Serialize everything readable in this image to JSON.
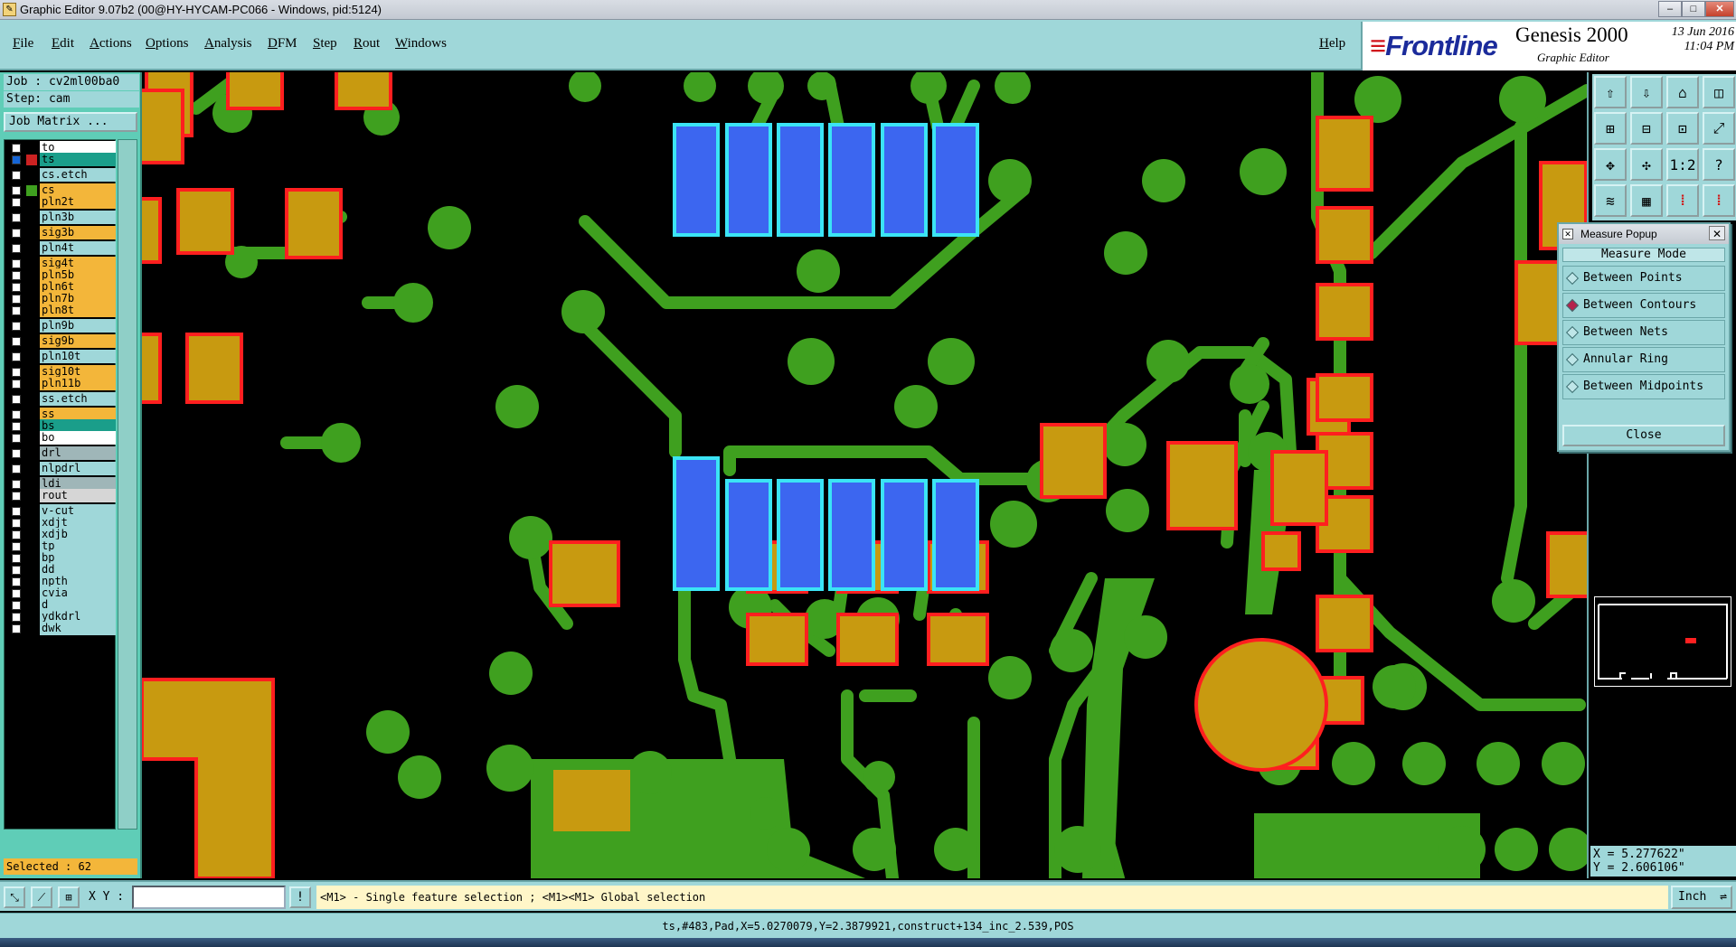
{
  "window": {
    "title": "Graphic Editor 9.07b2 (00@HY-HYCAM-PC066 - Windows, pid:5124)"
  },
  "menubar": {
    "items": [
      "File",
      "Edit",
      "Actions",
      "Options",
      "Analysis",
      "DFM",
      "Step",
      "Rout",
      "Windows"
    ],
    "help": "Help"
  },
  "brand": {
    "logo": "Frontline",
    "product": "Genesis 2000",
    "subtitle": "Graphic Editor",
    "date": "13 Jun 2016",
    "time": "11:04 PM"
  },
  "job": {
    "job_line": "Job : cv2ml00ba0",
    "step_line": "Step: cam",
    "matrix_button": "Job Matrix ..."
  },
  "layers": [
    {
      "name": "to",
      "color": "#ffffff",
      "swatch": "#000000",
      "checked": false
    },
    {
      "name": "ts",
      "color": "#1a9e8a",
      "swatch": "#cc2222",
      "checked": true
    },
    {
      "name": "cs.etch",
      "color": "#9fd7d9",
      "swatch": "#000000",
      "checked": false
    },
    {
      "name": "cs",
      "color": "#f3b63a",
      "swatch": "#3fa01f",
      "checked": false
    },
    {
      "name": "pln2t",
      "color": "#f3b63a",
      "swatch": "#000000",
      "checked": false
    },
    {
      "name": "pln3b",
      "color": "#9fd7d9",
      "swatch": "#000000",
      "checked": false
    },
    {
      "name": "sig3b",
      "color": "#f3b63a",
      "swatch": "#000000",
      "checked": false
    },
    {
      "name": "pln4t",
      "color": "#9fd7d9",
      "swatch": "#000000",
      "checked": false
    },
    {
      "name": "sig4t",
      "color": "#f3b63a",
      "swatch": "#000000",
      "checked": false
    },
    {
      "name": "pln5b",
      "color": "#f3b63a",
      "swatch": "#000000",
      "checked": false
    },
    {
      "name": "pln6t",
      "color": "#f3b63a",
      "swatch": "#000000",
      "checked": false
    },
    {
      "name": "pln7b",
      "color": "#f3b63a",
      "swatch": "#000000",
      "checked": false
    },
    {
      "name": "pln8t",
      "color": "#f3b63a",
      "swatch": "#000000",
      "checked": false
    },
    {
      "name": "pln9b",
      "color": "#9fd7d9",
      "swatch": "#000000",
      "checked": false
    },
    {
      "name": "sig9b",
      "color": "#f3b63a",
      "swatch": "#000000",
      "checked": false
    },
    {
      "name": "pln10t",
      "color": "#9fd7d9",
      "swatch": "#000000",
      "checked": false
    },
    {
      "name": "sig10t",
      "color": "#f3b63a",
      "swatch": "#000000",
      "checked": false
    },
    {
      "name": "pln11b",
      "color": "#f3b63a",
      "swatch": "#000000",
      "checked": false
    },
    {
      "name": "ss.etch",
      "color": "#9fd7d9",
      "swatch": "#000000",
      "checked": false
    },
    {
      "name": "ss",
      "color": "#f3b63a",
      "swatch": "#000000",
      "checked": false
    },
    {
      "name": "bs",
      "color": "#1a9e8a",
      "swatch": "#000000",
      "checked": false
    },
    {
      "name": "bo",
      "color": "#ffffff",
      "swatch": "#000000",
      "checked": false
    },
    {
      "name": "drl",
      "color": "#9fb6b8",
      "swatch": "#000000",
      "checked": false
    },
    {
      "name": "nlpdrl",
      "color": "#9fd7d9",
      "swatch": "#000000",
      "checked": false
    },
    {
      "name": "ldi",
      "color": "#9fb6b8",
      "swatch": "#000000",
      "checked": false
    },
    {
      "name": "rout",
      "color": "#d6d6d6",
      "swatch": "#000000",
      "checked": false
    },
    {
      "name": "v-cut",
      "color": "#9fd7d9",
      "swatch": "#000000",
      "checked": false
    },
    {
      "name": "xdjt",
      "color": "#9fd7d9",
      "swatch": "#000000",
      "checked": false
    },
    {
      "name": "xdjb",
      "color": "#9fd7d9",
      "swatch": "#000000",
      "checked": false
    },
    {
      "name": "tp",
      "color": "#9fd7d9",
      "swatch": "#000000",
      "checked": false
    },
    {
      "name": "bp",
      "color": "#9fd7d9",
      "swatch": "#000000",
      "checked": false
    },
    {
      "name": "dd",
      "color": "#9fd7d9",
      "swatch": "#000000",
      "checked": false
    },
    {
      "name": "npth",
      "color": "#9fd7d9",
      "swatch": "#000000",
      "checked": false
    },
    {
      "name": "cvia",
      "color": "#9fd7d9",
      "swatch": "#000000",
      "checked": false
    },
    {
      "name": "d",
      "color": "#9fd7d9",
      "swatch": "#000000",
      "checked": false
    },
    {
      "name": "ydkdrl",
      "color": "#9fd7d9",
      "swatch": "#000000",
      "checked": false
    },
    {
      "name": "dwk",
      "color": "#9fd7d9",
      "swatch": "#000000",
      "checked": false
    }
  ],
  "selection": {
    "label": "Selected : 62"
  },
  "measure_popup": {
    "title": "Measure Popup",
    "header": "Measure Mode",
    "options": [
      {
        "label": "Between Points",
        "selected": false
      },
      {
        "label": "Between Contours",
        "selected": true
      },
      {
        "label": "Between Nets",
        "selected": false
      },
      {
        "label": "Annular Ring",
        "selected": false
      },
      {
        "label": "Between Midpoints",
        "selected": false
      }
    ],
    "close": "Close"
  },
  "tools": [
    {
      "icon": "home-icon"
    },
    {
      "icon": "save-icon"
    },
    {
      "icon": "house-icon"
    },
    {
      "icon": "panel-icon"
    },
    {
      "icon": "zoom-in-icon"
    },
    {
      "icon": "zoom-out-icon"
    },
    {
      "icon": "zoom-area-icon"
    },
    {
      "icon": "pan-icon"
    },
    {
      "icon": "fit-icon"
    },
    {
      "icon": "center-icon"
    },
    {
      "icon": "ratio-icon"
    },
    {
      "icon": "help-icon"
    },
    {
      "icon": "layer-icon"
    },
    {
      "icon": "grid-icon"
    },
    {
      "icon": "snap-red-icon"
    },
    {
      "icon": "snap-red2-icon"
    }
  ],
  "tool_glyphs": [
    "⇧",
    "⇩",
    "⌂",
    "◫",
    "⊞",
    "⊟",
    "⊡",
    "⤢",
    "✥",
    "✣",
    "1:2",
    "?",
    "≋",
    "▦",
    "⁞",
    "⁞"
  ],
  "coords": {
    "x": "X = 5.277622\"",
    "y": "Y = 2.606106\""
  },
  "cmdbar": {
    "xy_label": "X Y :",
    "xy_value": "",
    "hint": "<M1> - Single feature selection ; <M1><M1> Global selection",
    "units": "Inch"
  },
  "status": {
    "text": "ts,#483,Pad,X=5.0270079,Y=2.3879921,construct+134_inc_2.539,POS"
  },
  "colors": {
    "trace": "#3fa01f",
    "pad_outline": "#ff1f1f",
    "pad_fill": "#c89a10",
    "selected_fill": "#3c66f0",
    "selected_outline": "#3be4f5",
    "panel": "#9fd7d9"
  }
}
